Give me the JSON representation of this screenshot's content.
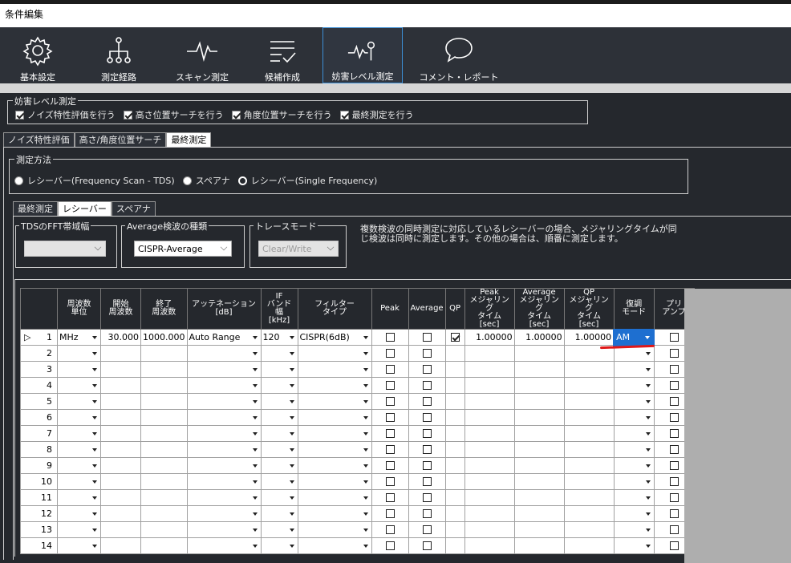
{
  "window": {
    "title": "条件編集"
  },
  "toolbar": {
    "items": [
      {
        "label": "基本設定",
        "icon": "gear-icon"
      },
      {
        "label": "測定経路",
        "icon": "hierarchy-icon"
      },
      {
        "label": "スキャン測定",
        "icon": "pulse-icon"
      },
      {
        "label": "候補作成",
        "icon": "checklist-icon"
      },
      {
        "label": "妨害レベル測定",
        "icon": "pulse-probe-icon",
        "active": true
      },
      {
        "label": "コメント・レポート",
        "icon": "speech-bubble-icon"
      }
    ]
  },
  "interference": {
    "title": "妨害レベル測定",
    "checks": [
      {
        "label": "ノイズ特性評価を行う",
        "checked": true
      },
      {
        "label": "高さ位置サーチを行う",
        "checked": true
      },
      {
        "label": "角度位置サーチを行う",
        "checked": true
      },
      {
        "label": "最終測定を行う",
        "checked": true
      }
    ]
  },
  "main_tabs": [
    "ノイズ特性評価",
    "高さ/角度位置サーチ",
    "最終測定"
  ],
  "method": {
    "title": "測定方法",
    "options": [
      {
        "label": "レシーバー(Frequency Scan - TDS)",
        "selected": false
      },
      {
        "label": "スペアナ",
        "selected": false
      },
      {
        "label": "レシーバー(Single Frequency)",
        "selected": true
      }
    ]
  },
  "sub_tabs": [
    "最終測定",
    "レシーバー",
    "スペアナ"
  ],
  "tds_fft": {
    "title": "TDSのFFT帯域幅",
    "value": ""
  },
  "average_type": {
    "title": "Average検波の種類",
    "value": "CISPR-Average"
  },
  "trace_mode": {
    "title": "トレースモード",
    "value": "Clear/Write"
  },
  "info": "複数検波の同時測定に対応しているレシーバーの場合、メジャリングタイムが同じ検波は同時に測定します。その他の場合は、順番に測定します。",
  "table": {
    "headers": [
      "周波数\n単位",
      "開始\n周波数",
      "終了\n周波数",
      "アッテネーション\n[dB]",
      "IF\nバンド\n幅\n[kHz]",
      "フィルター\nタイプ",
      "Peak",
      "Average",
      "QP",
      "Peak\nメジャリング\nタイム\n[sec]",
      "Average\nメジャリング\nタイム\n[sec]",
      "QP\nメジャリング\nタイム\n[sec]",
      "復調\nモード",
      "プリ\nアンプ"
    ],
    "rows": [
      {
        "n": "1",
        "unit": "MHz",
        "start": "30.000",
        "end": "1000.000",
        "att": "Auto Range",
        "ifbw": "120",
        "filter": "CISPR(6dB)",
        "peak": false,
        "avg": false,
        "qp": true,
        "pt": "1.00000",
        "at": "1.00000",
        "qt": "1.00000",
        "demod": "AM",
        "pre": false
      },
      {
        "n": "2"
      },
      {
        "n": "3"
      },
      {
        "n": "4"
      },
      {
        "n": "5"
      },
      {
        "n": "6"
      },
      {
        "n": "7"
      },
      {
        "n": "8"
      },
      {
        "n": "9"
      },
      {
        "n": "10"
      },
      {
        "n": "11"
      },
      {
        "n": "12"
      },
      {
        "n": "13"
      },
      {
        "n": "14"
      }
    ]
  }
}
